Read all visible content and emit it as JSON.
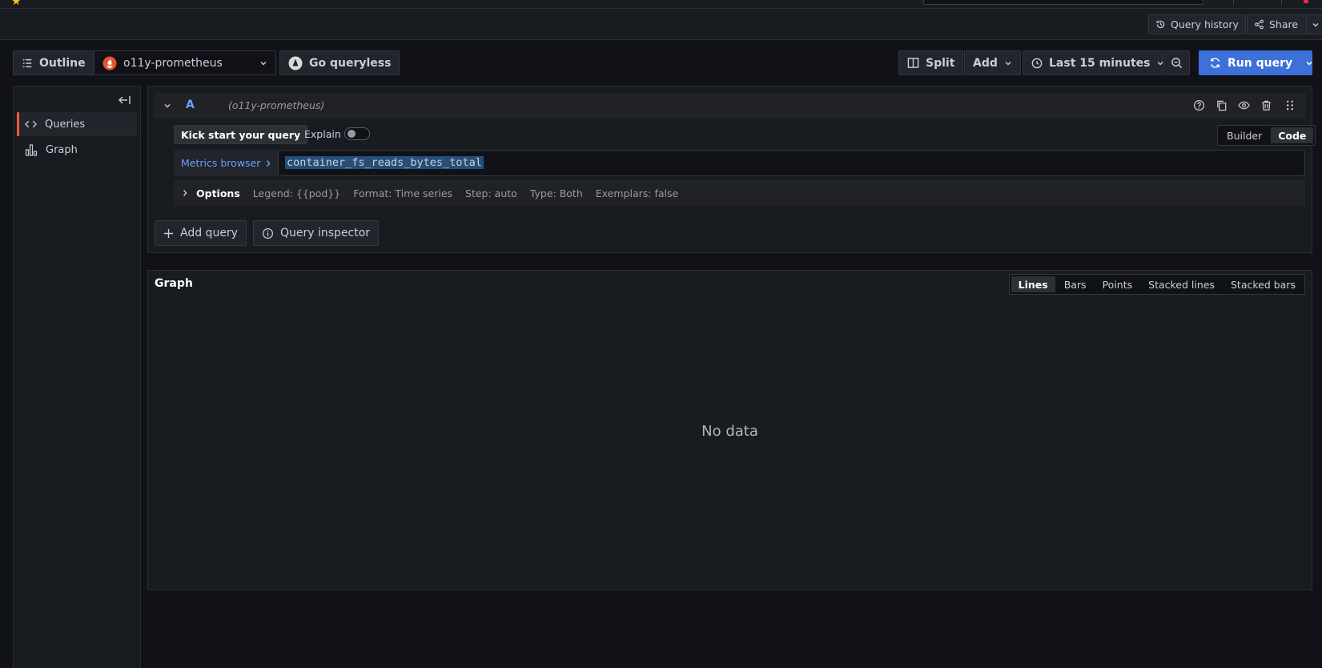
{
  "topbar": {
    "query_history_label": "Query history",
    "share_label": "Share"
  },
  "toolbar": {
    "outline_label": "Outline",
    "datasource_name": "o11y-prometheus",
    "go_queryless_label": "Go queryless",
    "split_label": "Split",
    "add_label": "Add",
    "time_range_label": "Last 15 minutes",
    "run_query_label": "Run query"
  },
  "outline": {
    "items": [
      {
        "label": "Queries",
        "icon": "code-brackets-icon"
      },
      {
        "label": "Graph",
        "icon": "bar-chart-icon"
      }
    ]
  },
  "query": {
    "ref_id": "A",
    "datasource_hint": "(o11y-prometheus)",
    "kick_start_label": "Kick start your query",
    "explain_label": "Explain",
    "mode_builder": "Builder",
    "mode_code": "Code",
    "metrics_browser_label": "Metrics browser",
    "expression": "container_fs_reads_bytes_total",
    "options": {
      "label": "Options",
      "legend": "Legend: {{pod}}",
      "format": "Format: Time series",
      "step": "Step: auto",
      "type": "Type: Both",
      "exemplars": "Exemplars: false"
    }
  },
  "query_actions": {
    "add_query_label": "Add query",
    "query_inspector_label": "Query inspector"
  },
  "graph": {
    "title": "Graph",
    "modes": [
      "Lines",
      "Bars",
      "Points",
      "Stacked lines",
      "Stacked bars"
    ],
    "active_mode": "Lines",
    "empty_text": "No data"
  },
  "colors": {
    "accent_blue": "#3d71d9",
    "active_indicator": "#ff5a3c",
    "link_blue": "#6e9fff"
  }
}
